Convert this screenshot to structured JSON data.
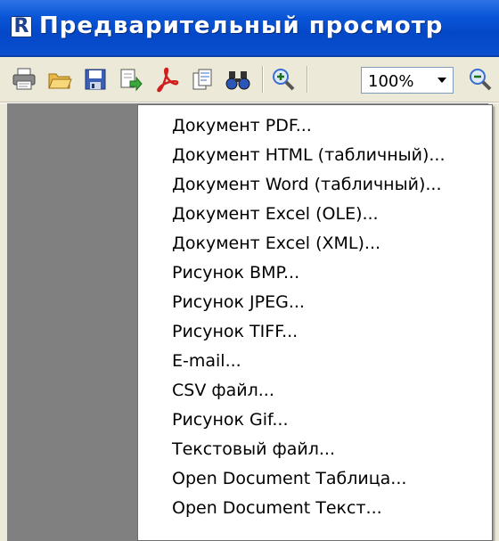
{
  "window": {
    "title": "Предварительный просмотр",
    "app_icon_letter": "R"
  },
  "toolbar": {
    "zoom_value": "100%",
    "buttons": [
      "print-icon",
      "open-folder-icon",
      "save-icon",
      "export-icon",
      "pdf-icon",
      "send-email-icon",
      "find-icon",
      "zoom-in-icon",
      "zoom-out-icon"
    ]
  },
  "menu": {
    "items": [
      "Документ PDF...",
      "Документ HTML (табличный)...",
      "Документ Word (табличный)...",
      "Документ Excel (OLE)...",
      "Документ Excel (XML)...",
      "Рисунок BMP...",
      "Рисунок JPEG...",
      "Рисунок TIFF...",
      "E-mail...",
      "CSV файл...",
      "Рисунок Gif...",
      "Текстовый файл...",
      "Open Document Таблица...",
      "Open Document Текст..."
    ]
  },
  "colors": {
    "titlebar": "#0a56d8",
    "toolbar": "#ece9d8",
    "preview_bg": "#808080",
    "menu_bg": "#ffffff"
  }
}
